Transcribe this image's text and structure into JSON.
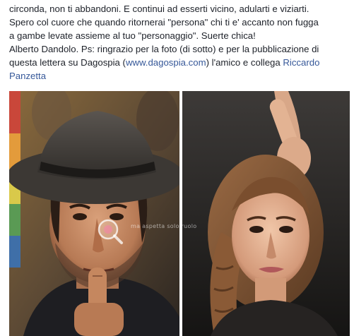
{
  "post": {
    "lines": [
      "circonda, non ti abbandoni. E continui ad esserti vicino, adularti e viziarti.",
      "Spero col cuore che quando ritornerai \"persona\" chi ti e' accanto non fugga",
      "a gambe levate assieme al tuo \"personaggio\". Suerte chica!",
      "Alberto Dandolo. Ps: ringrazio per la foto (di sotto) e per la pubblicazione di"
    ],
    "line5_before": "questa lettera su Dagospia (",
    "line5_link": "www.dagospia.com",
    "line5_middle": ") l'amico e collega ",
    "line5_name_link_first": "Riccardo",
    "line6_name_link_last": "Panzetta"
  },
  "photos": {
    "watermark_text": "ma aspetta solo ruolo"
  },
  "colors": {
    "text": "#1d2129",
    "link": "#365899",
    "divider": "#e5e5e5"
  }
}
